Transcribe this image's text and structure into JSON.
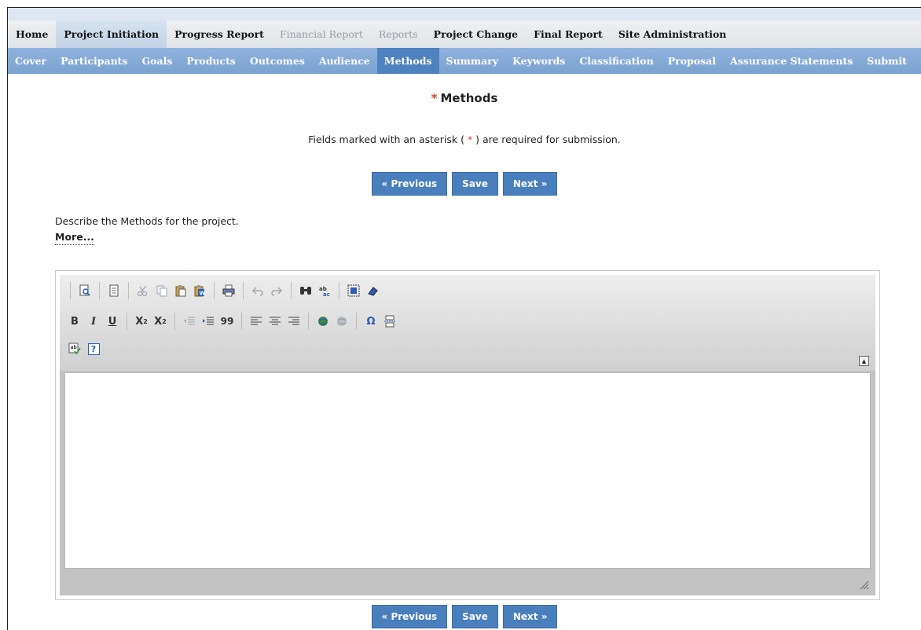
{
  "primary_nav": [
    {
      "label": "Home",
      "state": "normal"
    },
    {
      "label": "Project Initiation",
      "state": "active"
    },
    {
      "label": "Progress Report",
      "state": "normal"
    },
    {
      "label": "Financial Report",
      "state": "disabled"
    },
    {
      "label": "Reports",
      "state": "disabled"
    },
    {
      "label": "Project Change",
      "state": "normal"
    },
    {
      "label": "Final Report",
      "state": "normal"
    },
    {
      "label": "Site Administration",
      "state": "normal"
    }
  ],
  "secondary_nav": [
    {
      "label": "Cover"
    },
    {
      "label": "Participants"
    },
    {
      "label": "Goals"
    },
    {
      "label": "Products"
    },
    {
      "label": "Outcomes"
    },
    {
      "label": "Audience"
    },
    {
      "label": "Methods",
      "active": true
    },
    {
      "label": "Summary"
    },
    {
      "label": "Keywords"
    },
    {
      "label": "Classification"
    },
    {
      "label": "Proposal"
    },
    {
      "label": "Assurance Statements"
    },
    {
      "label": "Submit"
    }
  ],
  "page": {
    "asterisk": "*",
    "title": "Methods",
    "note_before": "Fields marked with an asterisk (",
    "note_asterisk": "*",
    "note_after": ") are required for submission.",
    "describe": "Describe the Methods for the project.",
    "more_link": "More..."
  },
  "buttons": {
    "previous": "« Previous",
    "save": "Save",
    "next": "Next »"
  },
  "editor": {
    "format_bold": "B",
    "format_italic": "I",
    "format_underline": "U",
    "subscript_base": "X",
    "subscript_mark": "2",
    "superscript_base": "X",
    "superscript_mark": "2",
    "blockquote": "99",
    "special_char": "Ω",
    "help": "?",
    "icons": {
      "row1": [
        "preview-icon",
        "templates-icon",
        "cut-icon",
        "copy-icon",
        "paste-icon",
        "paste-word-icon",
        "print-icon",
        "undo-icon",
        "redo-icon",
        "find-icon",
        "replace-icon",
        "select-all-icon",
        "remove-format-icon"
      ],
      "row2": [
        "bold-icon",
        "italic-icon",
        "underline-icon",
        "subscript-icon",
        "superscript-icon",
        "outdent-icon",
        "indent-icon",
        "blockquote-icon",
        "align-left-icon",
        "align-center-icon",
        "align-right-icon",
        "link-icon",
        "unlink-icon",
        "special-char-icon",
        "page-break-icon"
      ],
      "row3": [
        "spell-check-icon",
        "help-icon"
      ]
    }
  },
  "colors": {
    "primary_nav_active": "#c3d3e5",
    "secondary_nav_bg": "#7aa2cf",
    "secondary_nav_active": "#4f82be",
    "button_bg": "#4a7fbd",
    "asterisk": "#d83a2a"
  }
}
